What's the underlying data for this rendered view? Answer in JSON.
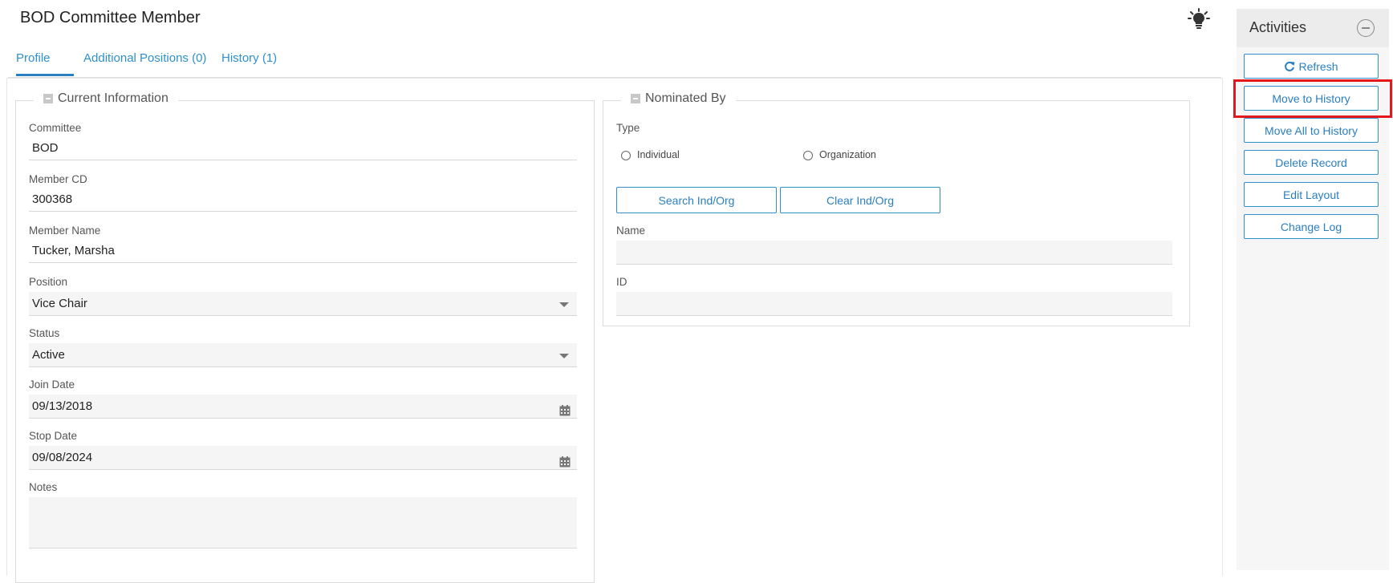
{
  "page": {
    "title": "BOD Committee Member"
  },
  "tabs": [
    {
      "label": "Profile",
      "active": true
    },
    {
      "label": "Additional Positions (0)",
      "active": false
    },
    {
      "label": "History (1)",
      "active": false
    }
  ],
  "current_info": {
    "legend": "Current Information",
    "committee": {
      "label": "Committee",
      "value": "BOD"
    },
    "member_cd": {
      "label": "Member CD",
      "value": "300368"
    },
    "member_name": {
      "label": "Member Name",
      "value": "Tucker, Marsha"
    },
    "position": {
      "label": "Position",
      "value": "Vice Chair"
    },
    "status": {
      "label": "Status",
      "value": "Active"
    },
    "join_date": {
      "label": "Join Date",
      "value": "09/13/2018"
    },
    "stop_date": {
      "label": "Stop Date",
      "value": "09/08/2024"
    },
    "notes": {
      "label": "Notes",
      "value": ""
    }
  },
  "nominated_by": {
    "legend": "Nominated By",
    "type_label": "Type",
    "type_options": [
      "Individual",
      "Organization"
    ],
    "search_button": "Search Ind/Org",
    "clear_button": "Clear Ind/Org",
    "name_label": "Name",
    "name_value": "",
    "id_label": "ID",
    "id_value": ""
  },
  "activities": {
    "title": "Activities",
    "buttons": [
      "Refresh",
      "Move to History",
      "Move All to History",
      "Delete Record",
      "Edit Layout",
      "Change Log"
    ]
  },
  "colors": {
    "accent": "#2a7fc0",
    "highlight": "#e4171c"
  },
  "icons": {
    "tip": "lightbulb-icon",
    "refresh": "refresh-icon",
    "calendar": "calendar-icon",
    "collapse": "collapse-icon"
  }
}
